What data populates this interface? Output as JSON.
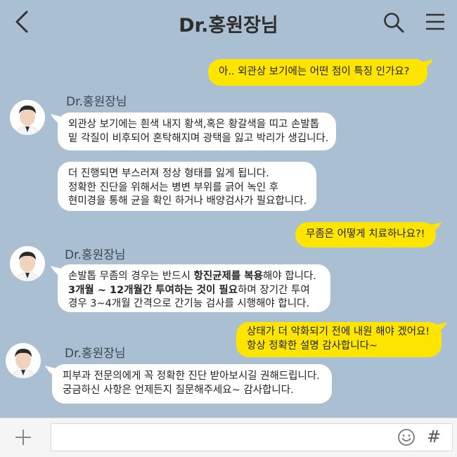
{
  "header": {
    "title": "Dr.홍원장님"
  },
  "messages": {
    "m1": {
      "text": "아.. 외관상 보기에는 어떤 점이 특징 인가요?"
    },
    "sender1": "Dr.홍원장님",
    "m2": {
      "line1": "외관상 보기에는 흰색 내지 황색,혹은 황갈색을 띠고 손발톱",
      "line2": "밑 각질이 비후되어 혼탁해지며 광택을 잃고 박리가 생깁니다."
    },
    "m3": {
      "line1": "더 진행되면 부스러져 정상 형태를 잃게 됩니다.",
      "line2": "정확한 진단을 위해서는 병변 부위를 긁어 녹인 후",
      "line3": "현미경을 통해 균을 확인 하거나 배양검사가 필요합니다."
    },
    "m4": {
      "text": "무좀은 어떻게 치료하나요?!"
    },
    "sender2": "Dr.홍원장님",
    "m5": {
      "l1a": "손발톱 무좀의 경우는 반드시 ",
      "l1b": "항진균제를 복용",
      "l1c": "해야 합니다.",
      "l2a": "3개월 ~ 12개월간 투여하는 것이 필요",
      "l2b": "하며 장기간 투여",
      "l3": "경우 3~4개월 간격으로 간기능 검사를 시행해야 합니다."
    },
    "m6": {
      "line1": "상태가 더 악화되기 전에 내원 해야 겠어요!",
      "line2": "항상 정확한 설명 감사합니다~"
    },
    "sender3": "Dr.홍원장님",
    "m7": {
      "line1": "피부과 전문의에게 꼭 정확한 진단 받아보시길 권해드립니다.",
      "line2": "궁금하신 사항은 언제든지 질문해주세요~ 감사합니다."
    }
  },
  "inputbar": {
    "hash_label": "#"
  },
  "colors": {
    "background": "#aac0d2",
    "my_bubble": "#fee500",
    "their_bubble": "#ffffff"
  },
  "icons": [
    "back-icon",
    "search-icon",
    "menu-icon",
    "plus-icon",
    "emoji-icon"
  ]
}
